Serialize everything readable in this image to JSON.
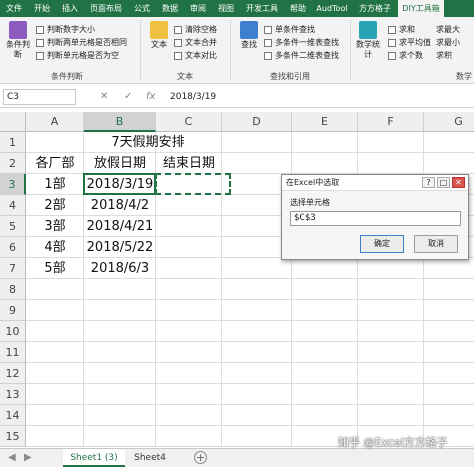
{
  "ribbon_tabs": [
    "文件",
    "开始",
    "插入",
    "页面布局",
    "公式",
    "数据",
    "审阅",
    "视图",
    "开发工具",
    "帮助",
    "AudTool",
    "方方格子",
    "DIY工具箱"
  ],
  "ribbon": {
    "group1": {
      "big_button": "条件判断",
      "items": [
        "判断数字大小",
        "判断两单元格是否相同",
        "判断单元格是否为空"
      ],
      "label": "条件判断"
    },
    "group2": {
      "big_button": "文本",
      "items": [
        "清除空格",
        "文本合并",
        "文本对比"
      ],
      "label": "文本"
    },
    "group3": {
      "big_button": "查找",
      "items": [
        "单条件查找",
        "多条件一维表查找",
        "多条件二维表查找"
      ],
      "label": "查找和引用"
    },
    "group4": {
      "big_button": "数学统计",
      "items": [
        "求和",
        "求平均值",
        "求个数"
      ],
      "label": ""
    },
    "group5": {
      "items": [
        "求最大",
        "求最小",
        "求积"
      ],
      "label": "数学"
    },
    "colors": {
      "accent": "#217346",
      "ribbon_bg": "#f3f3f3"
    }
  },
  "formula_bar": {
    "name_box": "C3",
    "cancel": "✕",
    "enter": "✓",
    "fx": "fx",
    "formula": "2018/3/19"
  },
  "grid": {
    "columns": [
      "A",
      "B",
      "C",
      "D",
      "E",
      "F",
      "G"
    ],
    "rows": [
      "1",
      "2",
      "3",
      "4",
      "5",
      "6",
      "7",
      "8",
      "9",
      "10",
      "11",
      "12",
      "13",
      "14",
      "15"
    ],
    "title": "7天假期安排",
    "headers": {
      "a2": "各厂部",
      "b2": "放假日期",
      "c2": "结束日期"
    },
    "data": [
      {
        "factory": "1部",
        "date": "2018/3/19"
      },
      {
        "factory": "2部",
        "date": "2018/4/2"
      },
      {
        "factory": "3部",
        "date": "2018/4/21"
      },
      {
        "factory": "4部",
        "date": "2018/5/22"
      },
      {
        "factory": "5部",
        "date": "2018/6/3"
      }
    ]
  },
  "dialog": {
    "title": "在Excel中选取",
    "help": "?",
    "restore": "□",
    "close": "✕",
    "label": "选择单元格",
    "value": "$C$3",
    "ok": "确定",
    "cancel": "取消"
  },
  "sheets": {
    "nav_prev": "◀",
    "nav_next": "▶",
    "tabs": [
      "Sheet1 (3)",
      "Sheet4"
    ],
    "add": "+"
  },
  "watermark": "知乎 @Excel方方格子"
}
